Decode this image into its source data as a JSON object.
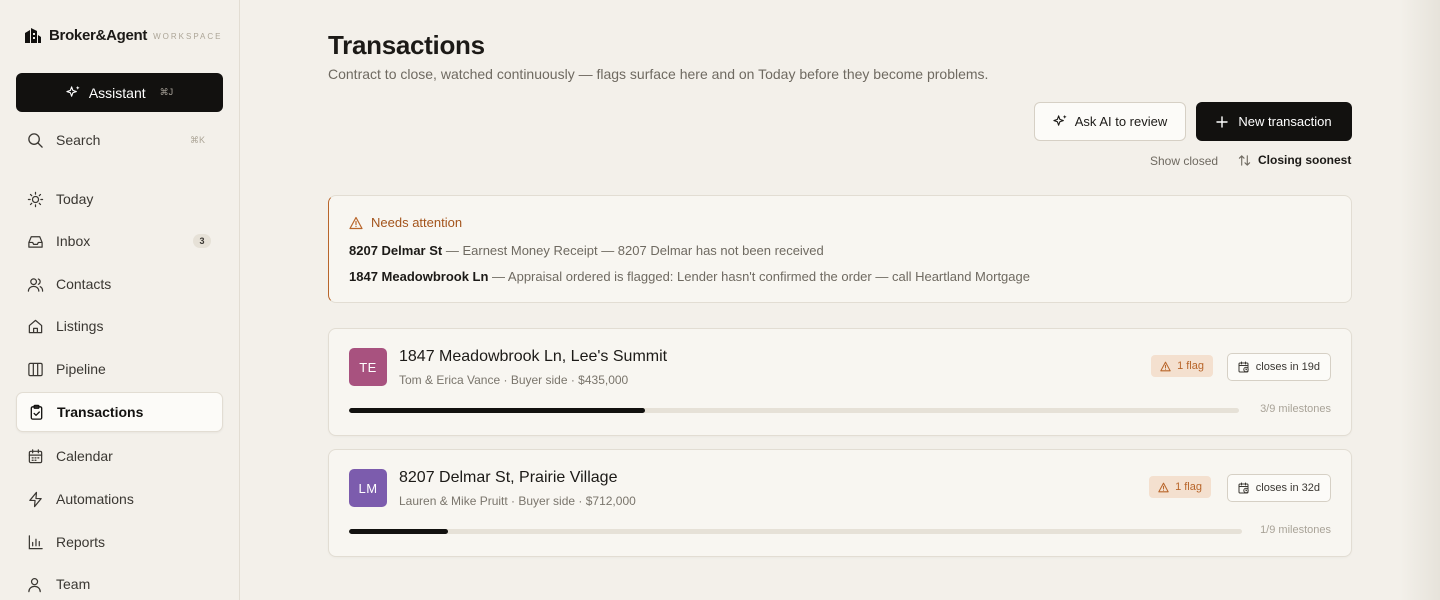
{
  "brand": {
    "name": "Broker&Agent",
    "sub": "WORKSPACE"
  },
  "assistant": {
    "label": "Assistant",
    "shortcut": "⌘J"
  },
  "search": {
    "label": "Search",
    "shortcut": "⌘K"
  },
  "nav": {
    "items": [
      {
        "label": "Today",
        "icon": "sun-icon"
      },
      {
        "label": "Inbox",
        "icon": "inbox-icon",
        "badge": "3"
      },
      {
        "label": "Contacts",
        "icon": "users-icon"
      },
      {
        "label": "Listings",
        "icon": "home-icon"
      },
      {
        "label": "Pipeline",
        "icon": "columns-icon"
      },
      {
        "label": "Transactions",
        "icon": "clipboard-check-icon",
        "active": true
      },
      {
        "label": "Calendar",
        "icon": "calendar-icon"
      },
      {
        "label": "Automations",
        "icon": "zap-icon"
      },
      {
        "label": "Reports",
        "icon": "bar-chart-icon"
      },
      {
        "label": "Team",
        "icon": "team-icon"
      }
    ]
  },
  "header": {
    "title": "Transactions",
    "subtitle": "Contract to close, watched continuously — flags surface here and on Today before they become problems."
  },
  "actions": {
    "ask_ai": "Ask AI to review",
    "new_transaction": "New transaction",
    "show_closed": "Show closed",
    "sort": "Closing soonest"
  },
  "attention": {
    "title": "Needs attention",
    "items": [
      {
        "address": "8207 Delmar St",
        "detail": " — Earnest Money Receipt — 8207 Delmar has not been received"
      },
      {
        "address": "1847 Meadowbrook Ln",
        "detail": " — Appraisal ordered is flagged: Lender hasn't confirmed the order — call Heartland Mortgage"
      }
    ]
  },
  "transactions": [
    {
      "initials": "TE",
      "avatar_color": "#a8527f",
      "title": "1847 Meadowbrook Ln, Lee's Summit",
      "subtitle": "Tom & Erica Vance · Buyer side · $435,000",
      "flag": "1 flag",
      "closes": "closes in 19d",
      "milestones": "3/9 milestones",
      "progress": 0.333
    },
    {
      "initials": "LM",
      "avatar_color": "#7c5cad",
      "title": "8207 Delmar St, Prairie Village",
      "subtitle": "Lauren & Mike Pruitt · Buyer side · $712,000",
      "flag": "1 flag",
      "closes": "closes in 32d",
      "milestones": "1/9 milestones",
      "progress": 0.111
    }
  ]
}
